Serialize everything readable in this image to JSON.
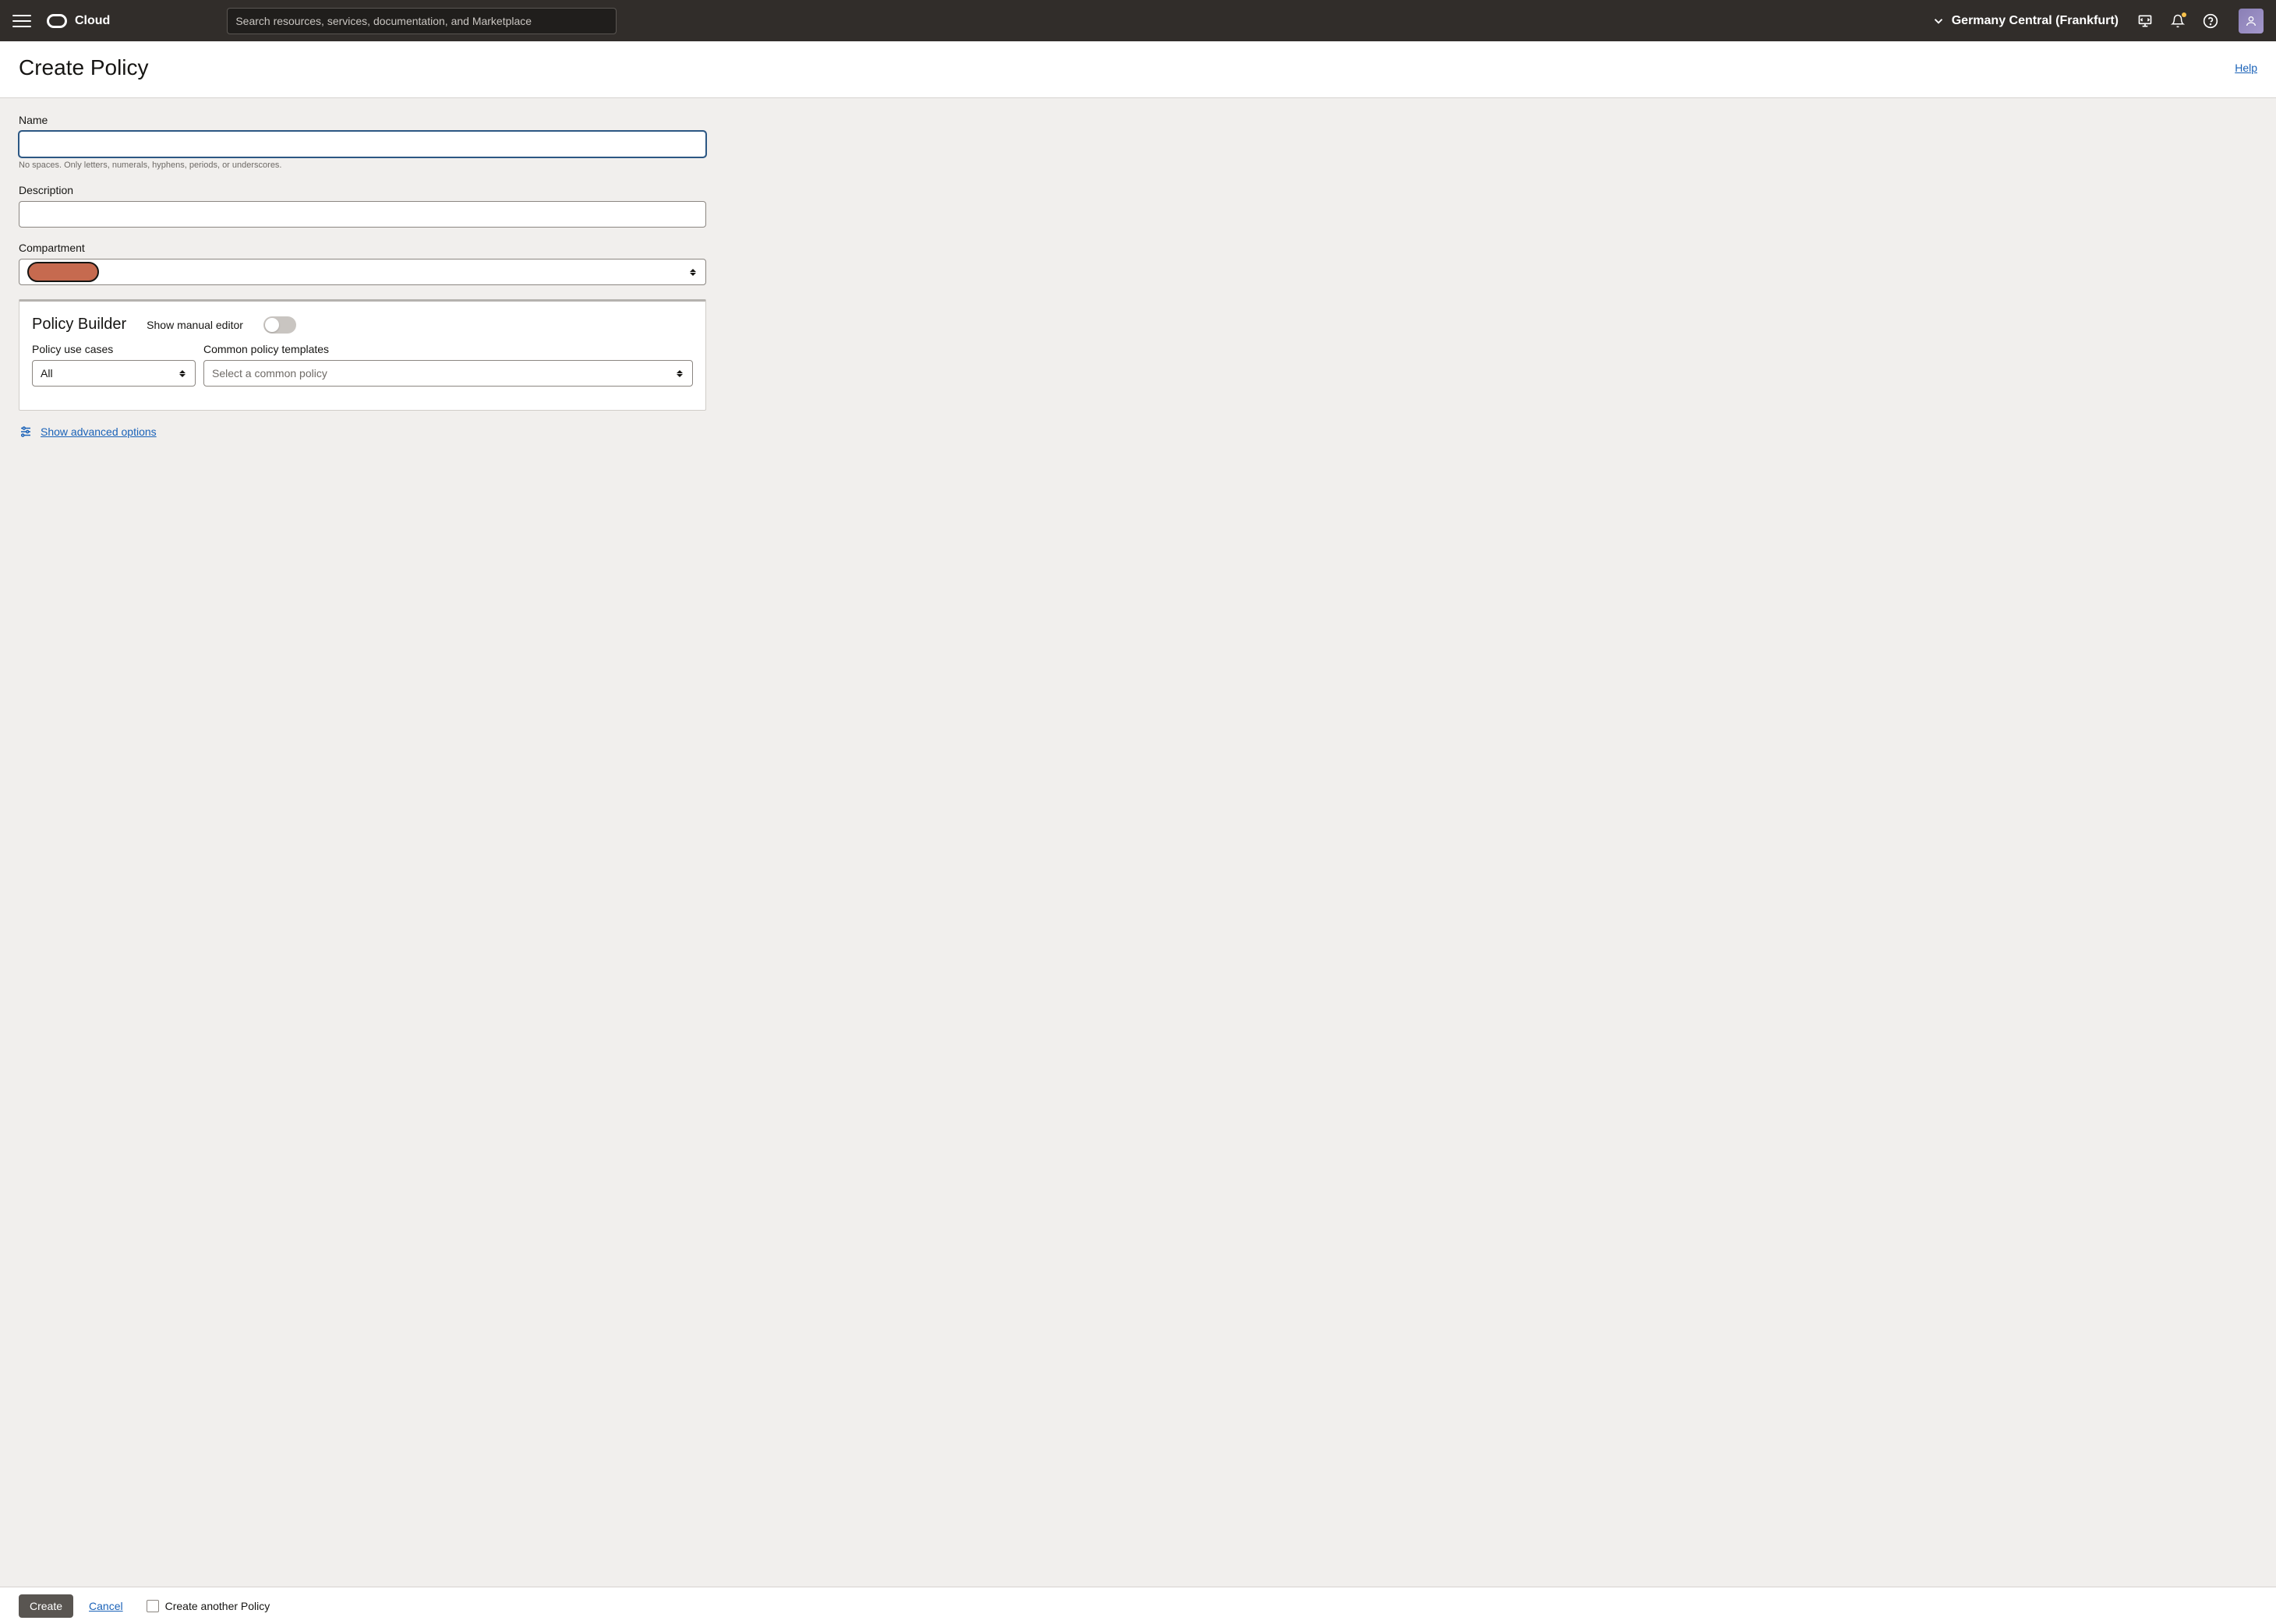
{
  "header": {
    "brand": "Cloud",
    "search_placeholder": "Search resources, services, documentation, and Marketplace",
    "region": "Germany Central (Frankfurt)"
  },
  "titlebar": {
    "page_title": "Create Policy",
    "help": "Help"
  },
  "form": {
    "name_label": "Name",
    "name_value": "",
    "name_hint": "No spaces. Only letters, numerals, hyphens, periods, or underscores.",
    "description_label": "Description",
    "description_value": "",
    "compartment_label": "Compartment",
    "compartment_value": ""
  },
  "builder": {
    "title": "Policy Builder",
    "manual_label": "Show manual editor",
    "manual_on": false,
    "usecases_label": "Policy use cases",
    "usecases_value": "All",
    "templates_label": "Common policy templates",
    "templates_placeholder": "Select a common policy"
  },
  "advanced": {
    "link": "Show advanced options"
  },
  "footer": {
    "create": "Create",
    "cancel": "Cancel",
    "create_another": "Create another Policy"
  }
}
